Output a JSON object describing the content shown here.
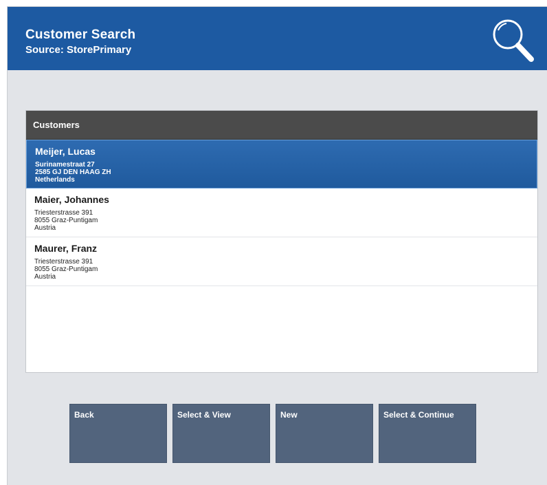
{
  "header": {
    "title": "Customer Search",
    "subtitle": "Source: StorePrimary",
    "icon": "search-icon",
    "background_color": "#1d5aa2"
  },
  "list": {
    "header": "Customers",
    "rows": [
      {
        "name": "Meijer, Lucas",
        "street": "Surinamestraat 27",
        "city": "2585 GJ DEN HAAG ZH",
        "country": "Netherlands",
        "selected": true
      },
      {
        "name": "Maier, Johannes",
        "street": "Triesterstrasse 391",
        "city": "8055 Graz-Puntigam",
        "country": "Austria",
        "selected": false
      },
      {
        "name": "Maurer, Franz",
        "street": "Triesterstrasse 391",
        "city": "8055 Graz-Puntigam",
        "country": "Austria",
        "selected": false
      }
    ]
  },
  "buttons": {
    "back": "Back",
    "select_view": "Select & View",
    "new": "New",
    "select_continue": "Select & Continue"
  },
  "colors": {
    "selected_row": "#2e6bb1",
    "list_header": "#4b4b4b",
    "button": "#52647d",
    "background": "#e2e4e8"
  }
}
